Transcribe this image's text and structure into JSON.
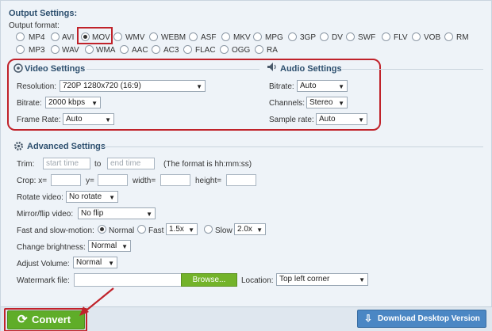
{
  "output": {
    "title": "Output Settings:",
    "format_label": "Output format:",
    "formats_row1": [
      "MP4",
      "AVI",
      "MOV",
      "WMV",
      "WEBM",
      "ASF",
      "MKV",
      "MPG",
      "3GP",
      "DV",
      "SWF",
      "FLV",
      "VOB",
      "RM"
    ],
    "formats_row2": [
      "MP3",
      "WAV",
      "WMA",
      "AAC",
      "AC3",
      "FLAC",
      "OGG",
      "RA"
    ],
    "selected": "MOV"
  },
  "video": {
    "title": "Video Settings",
    "resolution_label": "Resolution:",
    "resolution_value": "720P 1280x720 (16:9)",
    "bitrate_label": "Bitrate:",
    "bitrate_value": "2000 kbps",
    "framerate_label": "Frame Rate:",
    "framerate_value": "Auto"
  },
  "audio": {
    "title": "Audio Settings",
    "bitrate_label": "Bitrate:",
    "bitrate_value": "Auto",
    "channels_label": "Channels:",
    "channels_value": "Stereo",
    "samplerate_label": "Sample rate:",
    "samplerate_value": "Auto"
  },
  "advanced": {
    "title": "Advanced Settings",
    "trim_label": "Trim:",
    "trim_start_placeholder": "start time",
    "trim_to": "to",
    "trim_end_placeholder": "end time",
    "trim_hint": "(The format is hh:mm:ss)",
    "crop_label": "Crop: x=",
    "crop_y": "y=",
    "crop_width": "width=",
    "crop_height": "height=",
    "rotate_label": "Rotate video:",
    "rotate_value": "No rotate",
    "mirror_label": "Mirror/flip video:",
    "mirror_value": "No flip",
    "speed_label": "Fast and slow-motion:",
    "speed_normal": "Normal",
    "speed_fast": "Fast",
    "speed_fast_value": "1.5x",
    "speed_slow": "Slow",
    "speed_slow_value": "2.0x",
    "brightness_label": "Change brightness:",
    "brightness_value": "Normal",
    "volume_label": "Adjust Volume:",
    "volume_value": "Normal",
    "watermark_label": "Watermark file:",
    "browse_label": "Browse...",
    "location_label": "Location:",
    "location_value": "Top left corner"
  },
  "actions": {
    "convert_label": "Convert",
    "download_label": "Download Desktop Version"
  },
  "colors": {
    "highlight": "#c0222a",
    "convert": "#5fad29",
    "download": "#4b87c4"
  },
  "icons": [
    "video-settings-icon",
    "audio-settings-icon",
    "gear-icon",
    "refresh-icon",
    "download-icon",
    "arrow-annotation"
  ]
}
